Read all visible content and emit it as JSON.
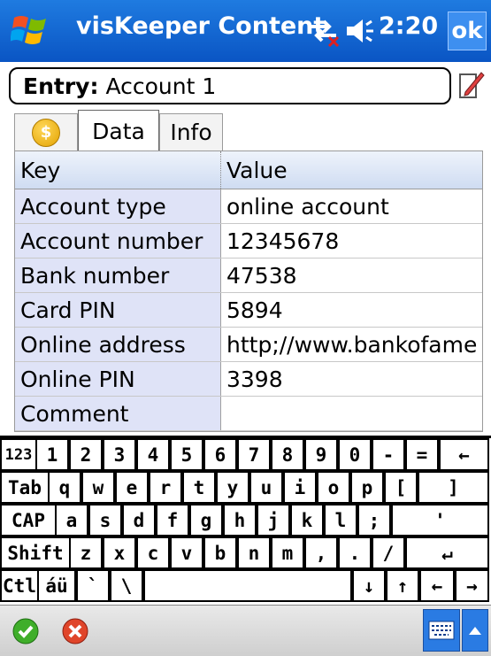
{
  "titlebar": {
    "title": "visKeeper Content",
    "time": "2:20",
    "ok_label": "ok"
  },
  "entry": {
    "label": "Entry:",
    "value": "Account 1"
  },
  "tabs": {
    "data": "Data",
    "info": "Info"
  },
  "table": {
    "headers": [
      "Key",
      "Value"
    ],
    "rows": [
      [
        "Account type",
        "online account"
      ],
      [
        "Account number",
        "12345678"
      ],
      [
        "Bank number",
        "47538"
      ],
      [
        "Card PIN",
        "5894"
      ],
      [
        "Online address",
        "http;//www.bankofame"
      ],
      [
        "Online PIN",
        "3398"
      ],
      [
        "Comment",
        ""
      ]
    ]
  },
  "keyboard": {
    "rows": [
      [
        "123",
        "1",
        "2",
        "3",
        "4",
        "5",
        "6",
        "7",
        "8",
        "9",
        "0",
        "-",
        "=",
        "←"
      ],
      [
        "Tab",
        "q",
        "w",
        "e",
        "r",
        "t",
        "y",
        "u",
        "i",
        "o",
        "p",
        "[",
        "]"
      ],
      [
        "CAP",
        "a",
        "s",
        "d",
        "f",
        "g",
        "h",
        "j",
        "k",
        "l",
        ";",
        "'"
      ],
      [
        "Shift",
        "z",
        "x",
        "c",
        "v",
        "b",
        "n",
        "m",
        ",",
        ".",
        "/",
        "↵"
      ],
      [
        "Ctl",
        "áü",
        "`",
        "\\",
        "",
        "↓",
        "↑",
        "←",
        "→"
      ]
    ]
  },
  "colors": {
    "titlebar": "#0a55c4",
    "accent": "#2a7be3",
    "key_column_bg": "#dfe3f7"
  }
}
